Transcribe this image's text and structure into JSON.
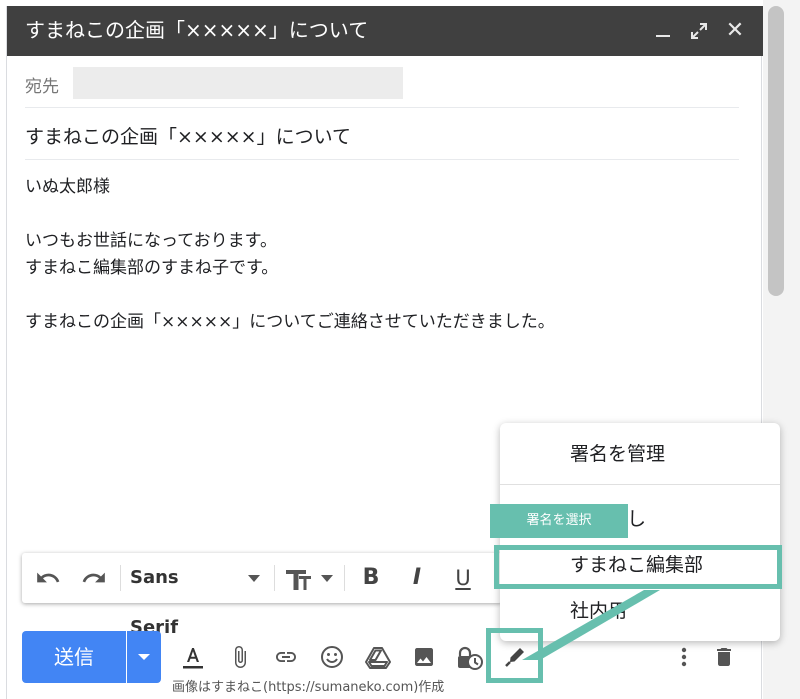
{
  "window": {
    "title": "すまねこの企画「×××××」について",
    "minimize_icon": "minimize-icon",
    "expand_icon": "expand-icon",
    "close_icon": "close-icon"
  },
  "recipients": {
    "label": "宛先",
    "value": ""
  },
  "subject": "すまねこの企画「×××××」について",
  "body": {
    "lines": [
      "いぬ太郎様",
      "",
      "いつもお世話になっております。",
      "すまねこ編集部のすまね子です。",
      "",
      "すまねこの企画「×××××」についてご連絡させていただきました。"
    ]
  },
  "format_toolbar": {
    "font": "Sans Serif",
    "icons": [
      "undo-icon",
      "redo-icon",
      "font-dropdown-icon",
      "text-size-icon",
      "bold-icon",
      "italic-icon",
      "underline-icon"
    ]
  },
  "bottom_bar": {
    "send_label": "送信",
    "icons": [
      "formatting-options-icon",
      "attach-file-icon",
      "insert-link-icon",
      "insert-emoji-icon",
      "google-drive-icon",
      "insert-photo-icon",
      "confidential-mode-icon",
      "insert-signature-icon",
      "more-options-icon",
      "delete-icon"
    ]
  },
  "signature_menu": {
    "manage_label": "署名を管理",
    "options": [
      "署名なし",
      "すまねこ編集部",
      "社内用"
    ],
    "selected": "すまねこ編集部"
  },
  "annotation": {
    "callout_label": "署名を選択",
    "accent_color": "#67bfae"
  },
  "credit": "画像はすまねこ(https://sumaneko.com)作成",
  "colors": {
    "titlebar": "#404040",
    "send_button": "#4285f4"
  }
}
